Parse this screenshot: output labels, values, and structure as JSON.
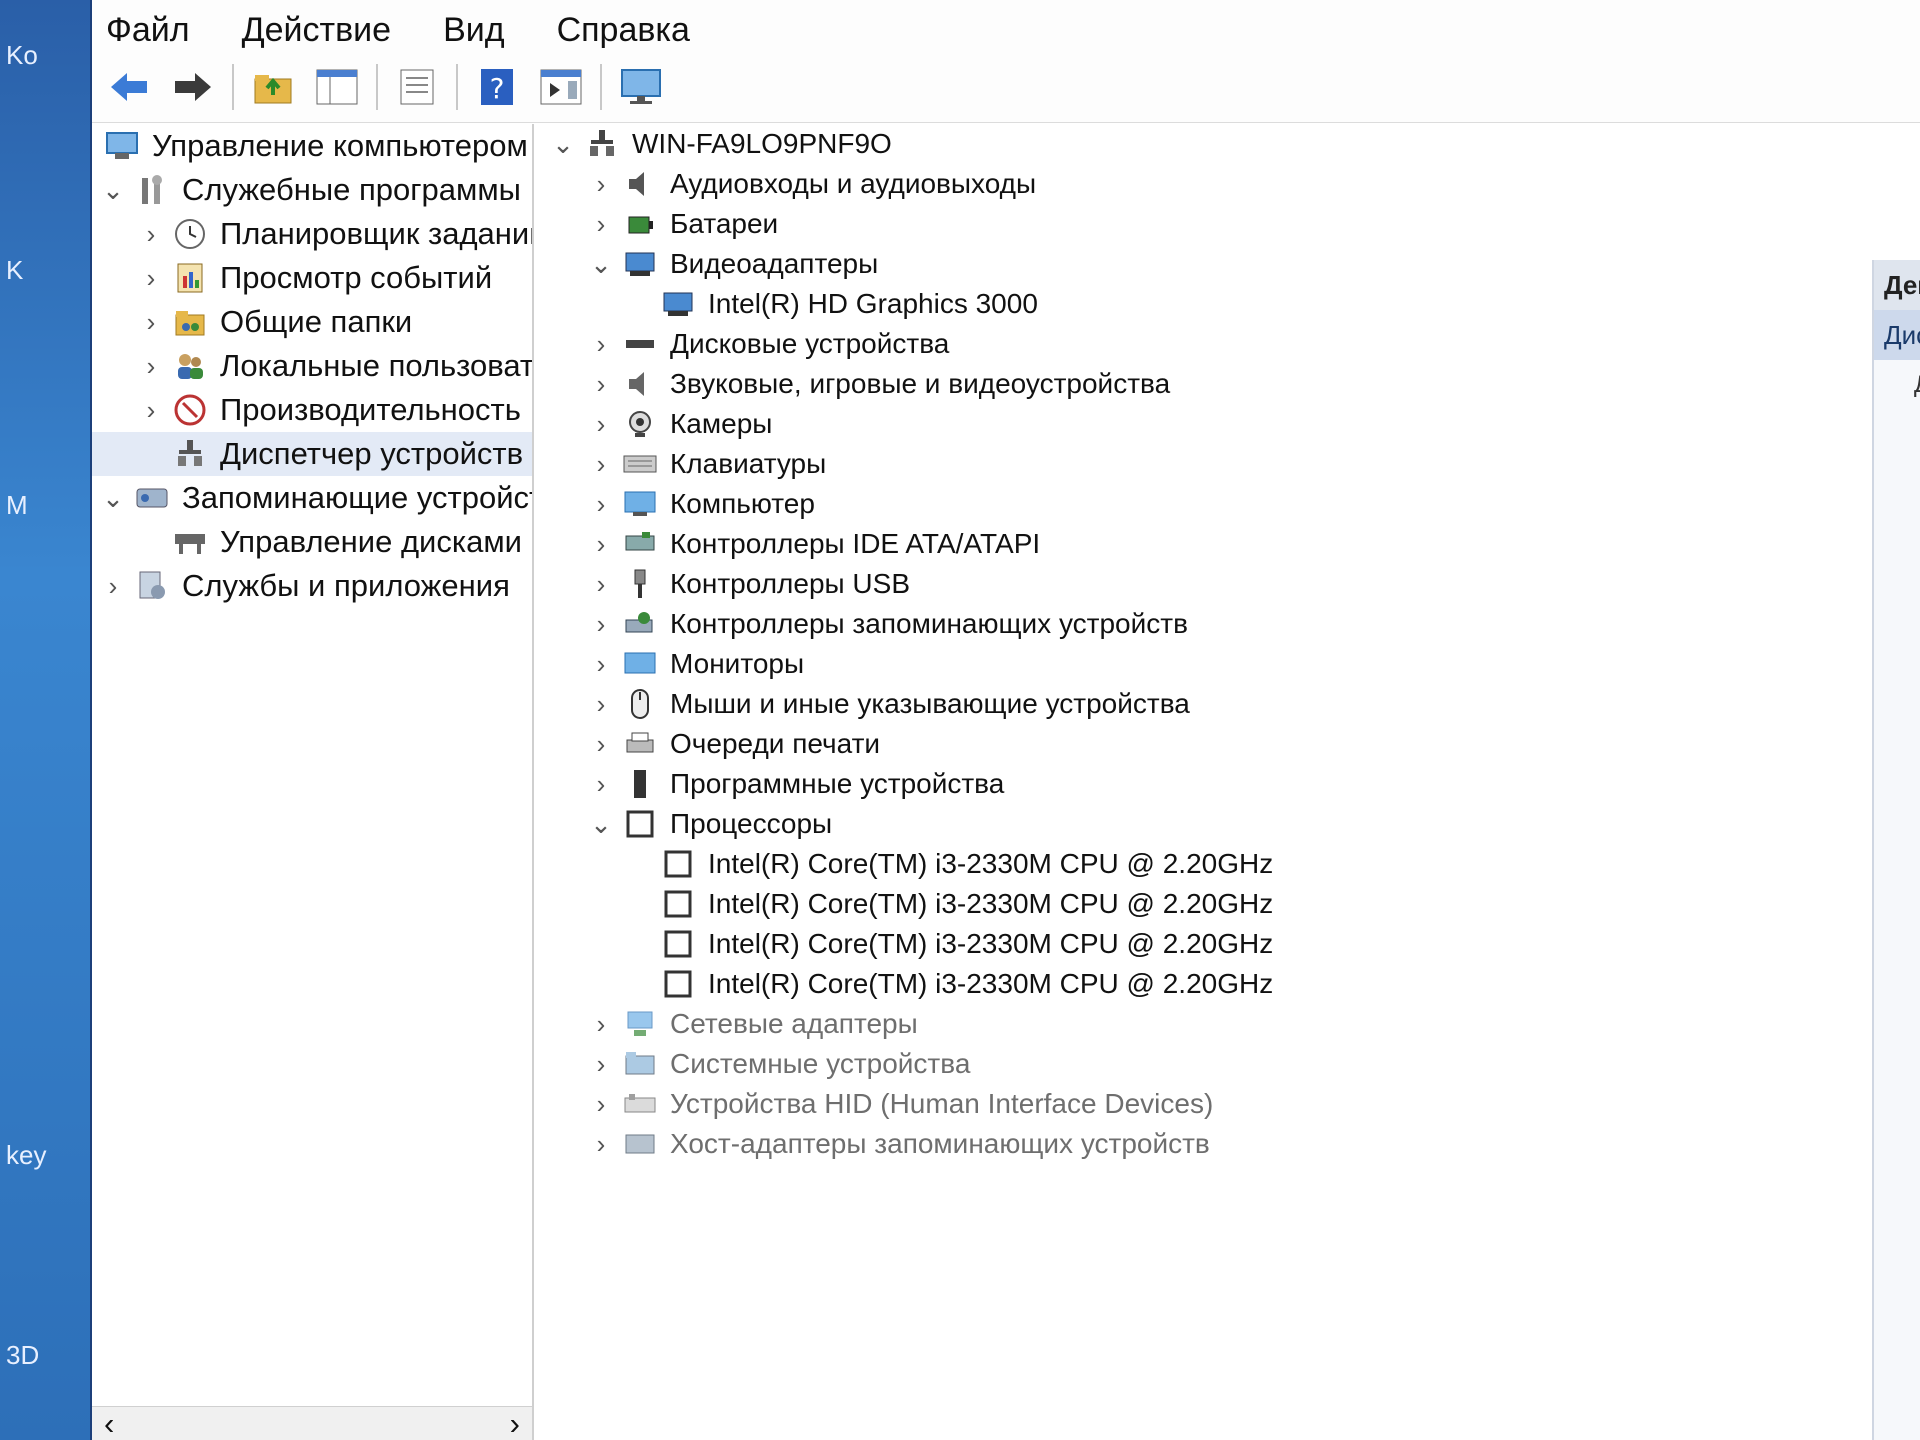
{
  "desktop": {
    "labels": [
      "Ko",
      "K",
      "M",
      "key",
      "3D"
    ]
  },
  "menubar": {
    "items": [
      "Файл",
      "Действие",
      "Вид",
      "Справка"
    ]
  },
  "toolbar": {
    "buttons": [
      "back-arrow-icon",
      "forward-arrow-icon",
      "up-folder-icon",
      "show-hide-tree-icon",
      "properties-icon",
      "help-icon",
      "action-pane-icon",
      "monitor-icon"
    ]
  },
  "left_tree": {
    "root": "Управление компьютером (л",
    "items": [
      {
        "label": "Служебные программы",
        "expanded": true,
        "icon": "tools-icon"
      },
      {
        "label": "Планировщик заданий",
        "icon": "clock-icon"
      },
      {
        "label": "Просмотр событий",
        "icon": "event-viewer-icon"
      },
      {
        "label": "Общие папки",
        "icon": "shared-folder-icon"
      },
      {
        "label": "Локальные пользовате",
        "icon": "users-icon"
      },
      {
        "label": "Производительность",
        "icon": "performance-icon"
      },
      {
        "label": "Диспетчер устройств",
        "icon": "device-manager-icon",
        "selected": true
      },
      {
        "label": "Запоминающие устройст",
        "expanded": true,
        "icon": "storage-icon"
      },
      {
        "label": "Управление дисками",
        "icon": "disk-management-icon"
      },
      {
        "label": "Службы и приложения",
        "icon": "services-icon"
      }
    ]
  },
  "device_tree": {
    "computer": "WIN-FA9LO9PNF9O",
    "categories": [
      {
        "label": "Аудиовходы и аудиовыходы",
        "icon": "speaker-icon"
      },
      {
        "label": "Батареи",
        "icon": "battery-icon"
      },
      {
        "label": "Видеоадаптеры",
        "icon": "display-adapter-icon",
        "expanded": true,
        "children": [
          "Intel(R) HD Graphics 3000"
        ]
      },
      {
        "label": "Дисковые устройства",
        "icon": "disk-drive-icon"
      },
      {
        "label": "Звуковые, игровые и видеоустройства",
        "icon": "sound-icon"
      },
      {
        "label": "Камеры",
        "icon": "camera-icon"
      },
      {
        "label": "Клавиатуры",
        "icon": "keyboard-icon"
      },
      {
        "label": "Компьютер",
        "icon": "computer-icon"
      },
      {
        "label": "Контроллеры IDE ATA/ATAPI",
        "icon": "ide-controller-icon"
      },
      {
        "label": "Контроллеры USB",
        "icon": "usb-icon"
      },
      {
        "label": "Контроллеры запоминающих устройств",
        "icon": "storage-controller-icon"
      },
      {
        "label": "Мониторы",
        "icon": "monitor-icon"
      },
      {
        "label": "Мыши и иные указывающие устройства",
        "icon": "mouse-icon"
      },
      {
        "label": "Очереди печати",
        "icon": "printer-icon"
      },
      {
        "label": "Программные устройства",
        "icon": "software-device-icon"
      },
      {
        "label": "Процессоры",
        "icon": "processor-icon",
        "expanded": true,
        "children": [
          "Intel(R) Core(TM) i3-2330M CPU @ 2.20GHz",
          "Intel(R) Core(TM) i3-2330M CPU @ 2.20GHz",
          "Intel(R) Core(TM) i3-2330M CPU @ 2.20GHz",
          "Intel(R) Core(TM) i3-2330M CPU @ 2.20GHz"
        ]
      },
      {
        "label": "Сетевые адаптеры",
        "icon": "network-adapter-icon"
      },
      {
        "label": "Системные устройства",
        "icon": "system-devices-icon"
      },
      {
        "label": "Устройства HID (Human Interface Devices)",
        "icon": "hid-icon"
      },
      {
        "label": "Хост-адаптеры запоминающих устройств",
        "icon": "storage-host-icon"
      }
    ]
  },
  "actions_panel": {
    "header": "Действи",
    "selected": "Диспетче",
    "more": "Допо."
  },
  "colors": {
    "accent": "#2b6cc4",
    "selection": "#e3eaf6",
    "desktop": "#2a5fa8"
  }
}
